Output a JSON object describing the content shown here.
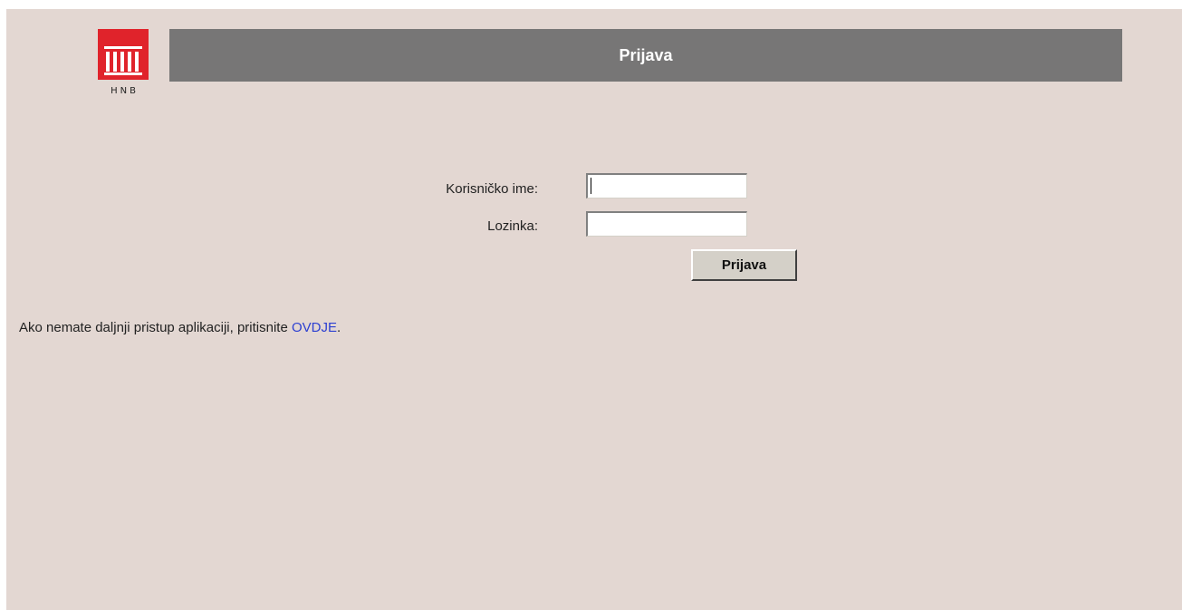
{
  "logo": {
    "text": "HNB",
    "icon": "columned-building-icon",
    "color": "#e0232b"
  },
  "header": {
    "title": "Prijava"
  },
  "form": {
    "username_label": "Korisničko ime:",
    "username_value": "",
    "password_label": "Lozinka:",
    "password_value": "",
    "submit_label": "Prijava"
  },
  "notice": {
    "text": "Ako nemate daljnji pristup aplikaciji, pritisnite ",
    "link_label": "OVDJE",
    "suffix": "."
  },
  "colors": {
    "page_background": "#e3d7d2",
    "header_background": "#777676",
    "link": "#2c3fd1"
  }
}
